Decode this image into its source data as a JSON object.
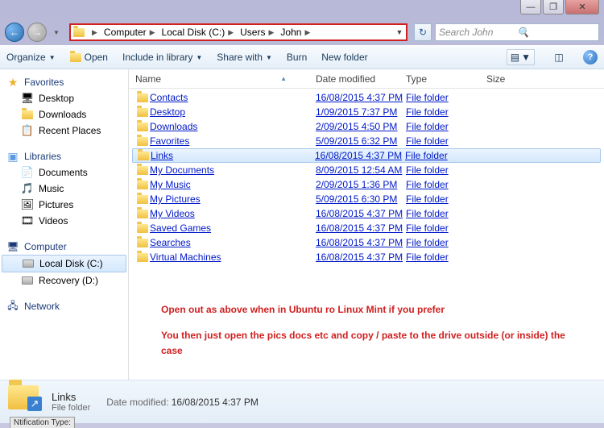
{
  "window": {
    "min": "—",
    "max": "❐",
    "close": "✕"
  },
  "breadcrumb": [
    "Computer",
    "Local Disk (C:)",
    "Users",
    "John"
  ],
  "search_placeholder": "Search John",
  "toolbar": {
    "organize": "Organize",
    "open": "Open",
    "include": "Include in library",
    "share": "Share with",
    "burn": "Burn",
    "newfolder": "New folder"
  },
  "columns": {
    "name": "Name",
    "date": "Date modified",
    "type": "Type",
    "size": "Size"
  },
  "sidebar": {
    "favorites": {
      "label": "Favorites",
      "items": [
        "Desktop",
        "Downloads",
        "Recent Places"
      ]
    },
    "libraries": {
      "label": "Libraries",
      "items": [
        "Documents",
        "Music",
        "Pictures",
        "Videos"
      ]
    },
    "computer": {
      "label": "Computer",
      "items": [
        "Local Disk (C:)",
        "Recovery (D:)"
      ]
    },
    "network": {
      "label": "Network"
    }
  },
  "files": [
    {
      "name": "Contacts",
      "date": "16/08/2015 4:37 PM",
      "type": "File folder",
      "sel": false
    },
    {
      "name": "Desktop",
      "date": "1/09/2015 7:37 PM",
      "type": "File folder",
      "sel": false
    },
    {
      "name": "Downloads",
      "date": "2/09/2015 4:50 PM",
      "type": "File folder",
      "sel": false
    },
    {
      "name": "Favorites",
      "date": "5/09/2015 6:32 PM",
      "type": "File folder",
      "sel": false
    },
    {
      "name": "Links",
      "date": "16/08/2015 4:37 PM",
      "type": "File folder",
      "sel": true
    },
    {
      "name": "My Documents",
      "date": "8/09/2015 12:54 AM",
      "type": "File folder",
      "sel": false
    },
    {
      "name": "My Music",
      "date": "2/09/2015 1:36 PM",
      "type": "File folder",
      "sel": false
    },
    {
      "name": "My Pictures",
      "date": "5/09/2015 6:30 PM",
      "type": "File folder",
      "sel": false
    },
    {
      "name": "My Videos",
      "date": "16/08/2015 4:37 PM",
      "type": "File folder",
      "sel": false
    },
    {
      "name": "Saved Games",
      "date": "16/08/2015 4:37 PM",
      "type": "File folder",
      "sel": false
    },
    {
      "name": "Searches",
      "date": "16/08/2015 4:37 PM",
      "type": "File folder",
      "sel": false
    },
    {
      "name": "Virtual Machines",
      "date": "16/08/2015 4:37 PM",
      "type": "File folder",
      "sel": false
    }
  ],
  "annotation": {
    "line1": "Open out as above when in Ubuntu ro Linux Mint if you prefer",
    "line2": "You then just open the pics docs etc and copy / paste to the drive outside (or inside) the case"
  },
  "details": {
    "name": "Links",
    "kind": "File folder",
    "meta_label": "Date modified:",
    "meta_value": "16/08/2015 4:37 PM"
  },
  "cutoff": "Ntification Type:"
}
